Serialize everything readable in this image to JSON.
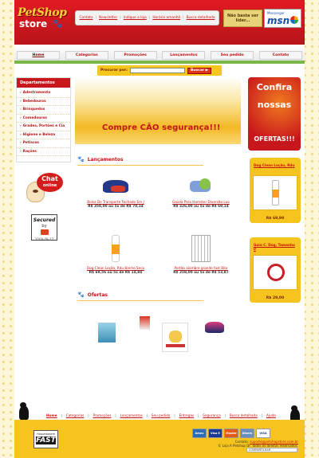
{
  "logo": {
    "line1": "PetShop",
    "line2": "store",
    "paw": "🐾"
  },
  "toplinks": [
    {
      "label": "Contato",
      "name": "toplink-contato"
    },
    {
      "label": "Newsletter",
      "name": "toplink-newsletter"
    },
    {
      "label": "Indique a loja",
      "name": "toplink-indique"
    },
    {
      "label": "Horário amanhã",
      "name": "toplink-horario"
    },
    {
      "label": "Busca detalhada",
      "name": "toplink-busca-detalhada"
    }
  ],
  "promo": {
    "text": "Não basta ser líder..."
  },
  "msn": {
    "small": "Messenger",
    "brand": "msn"
  },
  "nav": [
    "Home",
    "Categorias",
    "Promoções",
    "Lançamentos",
    "Seu pedido",
    "Contato"
  ],
  "search": {
    "label": "Procurar por:",
    "value": "",
    "button": "Buscar ▶"
  },
  "sidebar": {
    "title": "Departamentos",
    "items": [
      "Adestramento",
      "Bebedouros",
      "Brinquedos",
      "Comedouros",
      "Grades, Portões e Cia",
      "Higiene e Beleza",
      "Petiscos",
      "Rações"
    ]
  },
  "chat": {
    "line1": "Chat",
    "line2": "online"
  },
  "secured": {
    "line1": "Secured",
    "line2": "by",
    "line3": "thawte",
    "date": "2009-09-27"
  },
  "banner": {
    "text": "Compre CÃO segurança!!!"
  },
  "sections": {
    "lancamentos": "Lançamentos",
    "ofertas": "Ofertas"
  },
  "products": [
    {
      "name": "Bolsa De Transporte Fechado Em J",
      "price": "R$ 358,00 ou 5x de R$ 70,14"
    },
    {
      "name": "Gaiola Para Hamster Diversão Luo",
      "price": "R$ 326,00 ou 5x de R$ 69,14"
    },
    {
      "name": "Dog Clean Loção, Rdu Banho Seco",
      "price": "R$ 69,56 ou 5x de R$ 14,84"
    },
    {
      "name": "Portão alambre grande fast Bito",
      "price": "R$ 258,00 ou 5x de R$ 53,87"
    }
  ],
  "right": {
    "confira": [
      "Confira",
      "nossas",
      "OFERTAS!!!"
    ],
    "cards": [
      {
        "title": "Dog Clean Loção, Rdu",
        "price": "R$ 69,90"
      },
      {
        "title": "Guia C. Dog, Tamanho 0",
        "price": "R$ 29,00"
      }
    ]
  },
  "footer_nav": [
    "Home",
    "Categorias",
    "Promoções",
    "Lançamentos",
    "Seu pedido",
    "Entregas",
    "Segurança",
    "Busca detalhada",
    "Ajuda"
  ],
  "footer": {
    "seal_small": "Hospedagem",
    "seal_big": "FAST",
    "cards": [
      "Amex",
      "Visa E",
      "Master",
      "Diners",
      "VISA"
    ],
    "contact_label": "Contato:",
    "contact_email": "suporte@petshopstore.com.br",
    "copyright": "© Loja A Petshop Dr. Todos os direitos reservados.",
    "share": "COMPARTILHAR"
  },
  "colors": {
    "brand_red": "#c8161d",
    "brand_yellow": "#f5c41f"
  }
}
